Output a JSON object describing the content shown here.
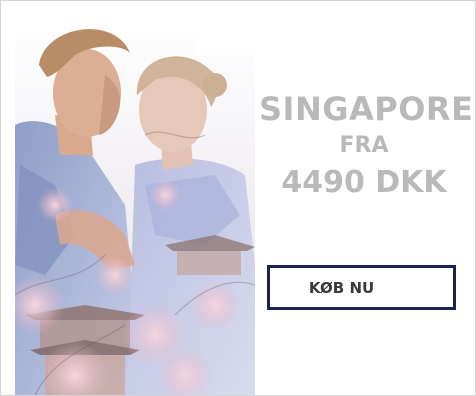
{
  "ad": {
    "destination": "SINGAPORE",
    "from_label": "FRA",
    "price": "4490 DKK",
    "cta_label": "KØB NU"
  },
  "colors": {
    "headline_text": "#b9b9b9",
    "cta_border": "#1c2257",
    "cta_text": "#3a3a3a",
    "background": "#ffffff"
  },
  "image": {
    "subject": "couple-double-exposure-with-cherry-blossoms-and-temple"
  }
}
